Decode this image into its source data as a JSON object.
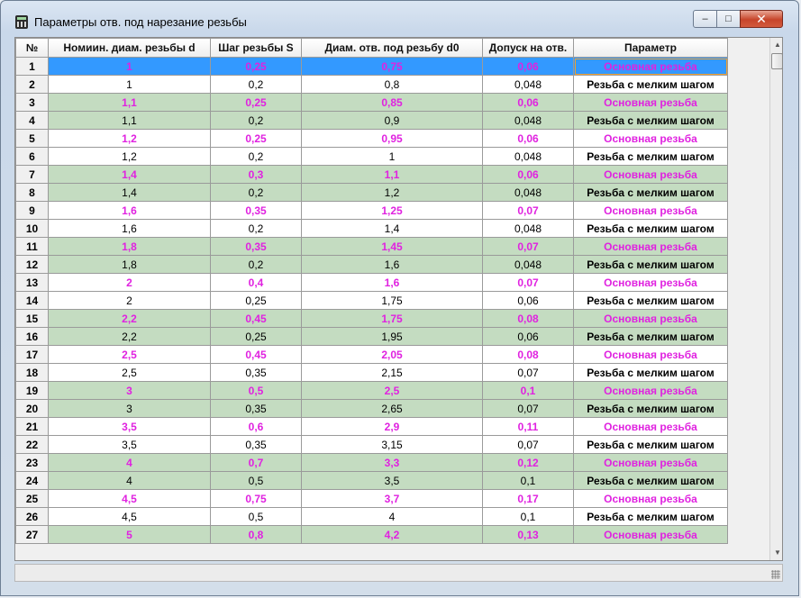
{
  "window": {
    "title": "Параметры отв. под нарезание резьбы",
    "min_glyph": "–",
    "max_glyph": "□",
    "close_glyph": "✕"
  },
  "table": {
    "columns": [
      "№",
      "Номиин. диам. резьбы d",
      "Шаг резьбы S",
      "Диам. отв. под резьбу d0",
      "Допуск на отв.",
      "Параметр"
    ],
    "rows": [
      {
        "n": "1",
        "d": "1",
        "s": "0,25",
        "d0": "0,75",
        "tol": "0,06",
        "param": "Основная резьба"
      },
      {
        "n": "2",
        "d": "1",
        "s": "0,2",
        "d0": "0,8",
        "tol": "0,048",
        "param": "Резьба с мелким шагом"
      },
      {
        "n": "3",
        "d": "1,1",
        "s": "0,25",
        "d0": "0,85",
        "tol": "0,06",
        "param": "Основная резьба"
      },
      {
        "n": "4",
        "d": "1,1",
        "s": "0,2",
        "d0": "0,9",
        "tol": "0,048",
        "param": "Резьба с мелким шагом"
      },
      {
        "n": "5",
        "d": "1,2",
        "s": "0,25",
        "d0": "0,95",
        "tol": "0,06",
        "param": "Основная резьба"
      },
      {
        "n": "6",
        "d": "1,2",
        "s": "0,2",
        "d0": "1",
        "tol": "0,048",
        "param": "Резьба с мелким шагом"
      },
      {
        "n": "7",
        "d": "1,4",
        "s": "0,3",
        "d0": "1,1",
        "tol": "0,06",
        "param": "Основная резьба"
      },
      {
        "n": "8",
        "d": "1,4",
        "s": "0,2",
        "d0": "1,2",
        "tol": "0,048",
        "param": "Резьба с мелким шагом"
      },
      {
        "n": "9",
        "d": "1,6",
        "s": "0,35",
        "d0": "1,25",
        "tol": "0,07",
        "param": "Основная резьба"
      },
      {
        "n": "10",
        "d": "1,6",
        "s": "0,2",
        "d0": "1,4",
        "tol": "0,048",
        "param": "Резьба с мелким шагом"
      },
      {
        "n": "11",
        "d": "1,8",
        "s": "0,35",
        "d0": "1,45",
        "tol": "0,07",
        "param": "Основная резьба"
      },
      {
        "n": "12",
        "d": "1,8",
        "s": "0,2",
        "d0": "1,6",
        "tol": "0,048",
        "param": "Резьба с мелким шагом"
      },
      {
        "n": "13",
        "d": "2",
        "s": "0,4",
        "d0": "1,6",
        "tol": "0,07",
        "param": "Основная резьба"
      },
      {
        "n": "14",
        "d": "2",
        "s": "0,25",
        "d0": "1,75",
        "tol": "0,06",
        "param": "Резьба с мелким шагом"
      },
      {
        "n": "15",
        "d": "2,2",
        "s": "0,45",
        "d0": "1,75",
        "tol": "0,08",
        "param": "Основная резьба"
      },
      {
        "n": "16",
        "d": "2,2",
        "s": "0,25",
        "d0": "1,95",
        "tol": "0,06",
        "param": "Резьба с мелким шагом"
      },
      {
        "n": "17",
        "d": "2,5",
        "s": "0,45",
        "d0": "2,05",
        "tol": "0,08",
        "param": "Основная резьба"
      },
      {
        "n": "18",
        "d": "2,5",
        "s": "0,35",
        "d0": "2,15",
        "tol": "0,07",
        "param": "Резьба с мелким шагом"
      },
      {
        "n": "19",
        "d": "3",
        "s": "0,5",
        "d0": "2,5",
        "tol": "0,1",
        "param": "Основная резьба"
      },
      {
        "n": "20",
        "d": "3",
        "s": "0,35",
        "d0": "2,65",
        "tol": "0,07",
        "param": "Резьба с мелким шагом"
      },
      {
        "n": "21",
        "d": "3,5",
        "s": "0,6",
        "d0": "2,9",
        "tol": "0,11",
        "param": "Основная резьба"
      },
      {
        "n": "22",
        "d": "3,5",
        "s": "0,35",
        "d0": "3,15",
        "tol": "0,07",
        "param": "Резьба с мелким шагом"
      },
      {
        "n": "23",
        "d": "4",
        "s": "0,7",
        "d0": "3,3",
        "tol": "0,12",
        "param": "Основная резьба"
      },
      {
        "n": "24",
        "d": "4",
        "s": "0,5",
        "d0": "3,5",
        "tol": "0,1",
        "param": "Резьба с мелким шагом"
      },
      {
        "n": "25",
        "d": "4,5",
        "s": "0,75",
        "d0": "3,7",
        "tol": "0,17",
        "param": "Основная резьба"
      },
      {
        "n": "26",
        "d": "4,5",
        "s": "0,5",
        "d0": "4",
        "tol": "0,1",
        "param": "Резьба с мелким шагом"
      },
      {
        "n": "27",
        "d": "5",
        "s": "0,8",
        "d0": "4,2",
        "tol": "0,13",
        "param": "Основная резьба"
      }
    ]
  },
  "scrollbar": {
    "up_glyph": "▲",
    "down_glyph": "▼"
  },
  "colors": {
    "main_thread_text": "#e022e0",
    "fine_thread_text": "#000000",
    "row_band_green": "#c4dcc1",
    "row_band_white": "#ffffff",
    "selection": "#3399ff"
  }
}
